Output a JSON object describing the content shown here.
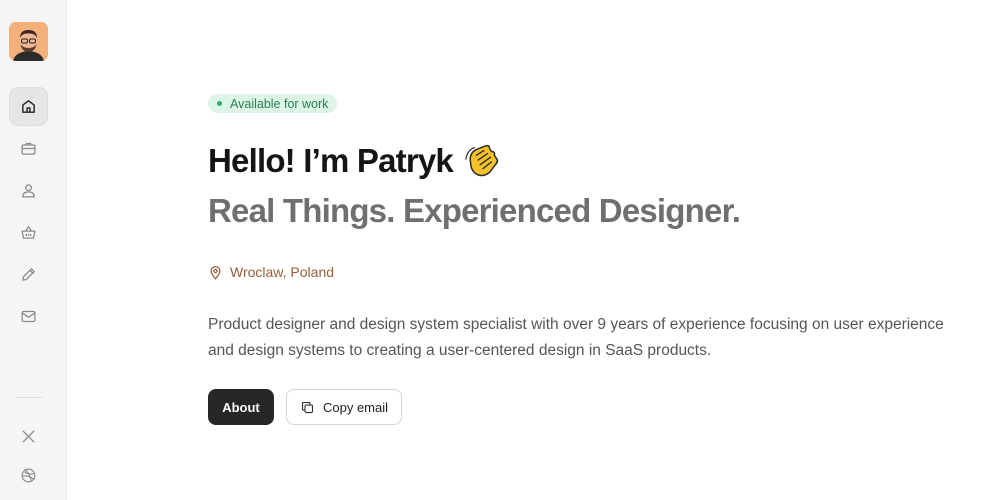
{
  "sidebar": {
    "avatar_alt": "Patryk avatar",
    "items": [
      {
        "icon": "home-icon",
        "active": true
      },
      {
        "icon": "briefcase-icon",
        "active": false
      },
      {
        "icon": "user-icon",
        "active": false
      },
      {
        "icon": "basket-icon",
        "active": false
      },
      {
        "icon": "pencil-icon",
        "active": false
      },
      {
        "icon": "mail-icon",
        "active": false
      }
    ],
    "social": [
      {
        "icon": "x-twitter-icon"
      },
      {
        "icon": "dribbble-icon"
      }
    ]
  },
  "hero": {
    "badge": "Available for work",
    "title": "Hello! I’m Patryk",
    "subtitle": "Real Things. Experienced Designer.",
    "location": "Wroclaw, Poland",
    "description": "Product designer and design system specialist with over 9 years of experience focusing on user experience and design systems to creating a user-centered design in SaaS products."
  },
  "actions": {
    "about_label": "About",
    "copy_email_label": "Copy email"
  },
  "colors": {
    "badge_bg": "#dcf5e7",
    "badge_text": "#2e7d4f",
    "location_text": "#9a5c3a",
    "primary_button": "#27272a"
  }
}
